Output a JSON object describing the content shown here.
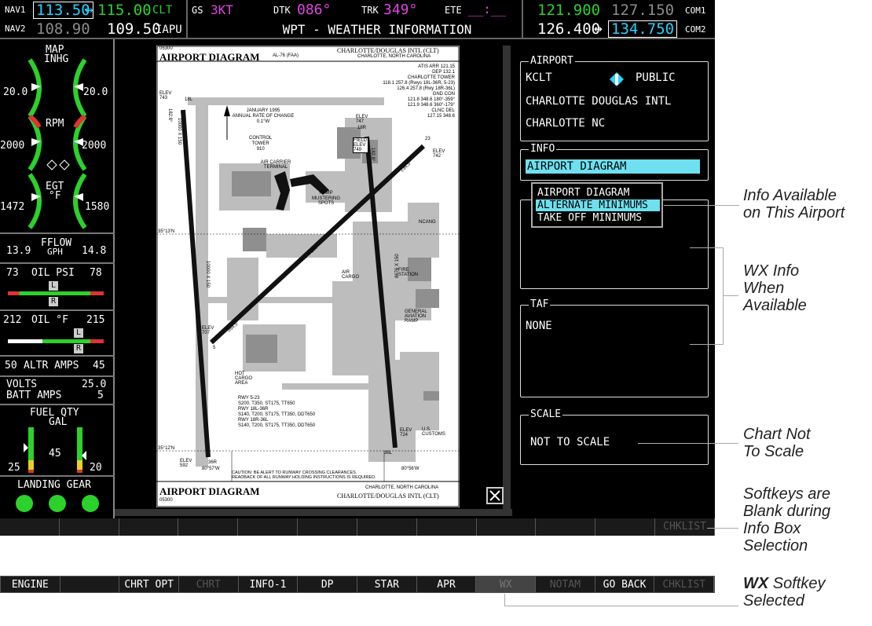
{
  "topbar": {
    "nav1_label": "NAV1",
    "nav1_active": "113.50",
    "nav1_arrow": "↔",
    "nav1_standby": "115.00",
    "nav1_id": "CLT",
    "nav2_label": "NAV2",
    "nav2_active": "108.90",
    "nav2_standby": "109.50",
    "nav2_id": "IAPU",
    "gs_label": "GS",
    "gs_value": "3KT",
    "dtk_label": "DTK",
    "dtk_value": "086°",
    "trk_label": "TRK",
    "trk_value": "349°",
    "ete_label": "ETE",
    "ete_value": "__:__",
    "page_title": "WPT - WEATHER INFORMATION",
    "com1_active": "121.900",
    "com1_standby": "127.150",
    "com1_label": "COM1",
    "com2_active": "126.400",
    "com2_arrow": "↔",
    "com2_standby": "134.750",
    "com2_label": "COM2"
  },
  "eis": {
    "map_label": "MAP",
    "inhg_label": "INHG",
    "map_left": "20.0",
    "map_right": "20.0",
    "rpm_label": "RPM",
    "rpm_left": "2000",
    "rpm_right": "2000",
    "egt_label": "EGT",
    "egt_unit": "°F",
    "egt_left": "1472",
    "egt_right": "1580",
    "fflow_label": "FFLOW",
    "fflow_unit": "GPH",
    "fflow_left": "13.9",
    "fflow_right": "14.8",
    "oilpsi_left": "73",
    "oilpsi_label": "OIL PSI",
    "oilpsi_right": "78",
    "oiltemp_left": "212",
    "oiltemp_label": "OIL °F",
    "oiltemp_right": "215",
    "altr_left": "50",
    "altr_label": "ALTR AMPS",
    "altr_right": "45",
    "volts_label": "VOLTS",
    "volts_value": "25.0",
    "batt_label": "BATT AMPS",
    "batt_value": "5",
    "fuel_label": "FUEL QTY",
    "fuel_unit": "GAL",
    "fuel_left": "25",
    "fuel_mid": "45",
    "fuel_right": "20",
    "gear_label": "LANDING GEAR",
    "l_marker": "L",
    "r_marker": "R"
  },
  "chart": {
    "code_top": "05300",
    "title": "AIRPORT DIAGRAM",
    "al_code": "AL-76 (FAA)",
    "airport_name": "CHARLOTTE/DOUGLAS INTL (CLT)",
    "city": "CHARLOTTE, NORTH CAROLINA",
    "atis": "ATIS ARR 121.15",
    "dep": "DEP 132.1",
    "tower_label": "CHARLOTTE TOWER",
    "tower_freq": "118.1 257.8 (Rwys 18L-36R, 5-23)",
    "tower_freq2": "126.4 257.8 (Rwy 18R-36L)",
    "gnd_label": "GND CON",
    "gnd1": "121.8 348.6 180°-359°",
    "gnd2": "121.9 348.6 360°-179°",
    "clnc_label": "CLNC DEL",
    "clnc": "127.15 348.6",
    "variation": "JANUARY 1995",
    "variation2": "ANNUAL RATE OF CHANGE",
    "variation3": "0.1°W",
    "control_tower": "CONTROL",
    "control_tower2": "TOWER",
    "control_tower3": "910",
    "terminal": "AIR CARRIER TERMINAL",
    "ramp": "RAMP",
    "ramp2": "MUSTERING SPOTS",
    "field_elev": "FIELD ELEV 749",
    "elev_743": "ELEV 743",
    "elev_747": "ELEV 747",
    "elev_742": "ELEV 742",
    "elev_707": "ELEV 707",
    "elev_724": "ELEV 724",
    "elev_592": "ELEV 592",
    "ncang": "NCANG",
    "fire_station": "FIRE STATION",
    "general_aviation": "GENERAL AVIATION RAMP",
    "air_cargo": "AIR CARGO",
    "hot_cargo": "HOT CARGO AREA",
    "customs": "U.S. CUSTOMS",
    "lat1": "35°13'N",
    "lat2": "35°12'N",
    "lon1": "80°57'W",
    "lon2": "80°56'W",
    "rwy_info": "RWY 5-23",
    "rwy_info2": "S200, T350, ST175, TT650",
    "rwy_info3": "RWY 18L-36R",
    "rwy_info4": "S140, T200, ST175, TT350, DDT650",
    "rwy_info5": "RWY 18R-36L",
    "rwy_info6": "S140, T200, ST175, TT350, DDT650",
    "caution": "CAUTION: BE ALERT TO RUNWAY CROSSING CLEARANCES.",
    "caution2": "READBACK OF ALL RUNWAY HOLDING INSTRUCTIONS IS REQUIRED.",
    "footer_title": "AIRPORT DIAGRAM",
    "footer_city": "CHARLOTTE, NORTH CAROLINA",
    "footer_name": "CHARLOTTE/DOUGLAS INTL (CLT)",
    "footer_code": "05300",
    "rwy_left_label": "10000 X 150",
    "rwy_right_label": "8676 X 150",
    "rwy_diag_label": "7502 X 150",
    "rwy_18l": "18L",
    "rwy_36r": "36R",
    "rwy_18r": "18R",
    "rwy_36l": "36L",
    "rwy_5": "5",
    "rwy_23": "23",
    "brg_left": "182.8°",
    "brg_right": "182.8°",
    "brg_5": "054.5°",
    "brg_23": "234.5°"
  },
  "panel": {
    "airport_title": "AIRPORT",
    "airport_id": "KCLT",
    "airport_type": "PUBLIC",
    "airport_name": "CHARLOTTE DOUGLAS INTL",
    "airport_city": "CHARLOTTE NC",
    "info_title": "INFO",
    "info_selected": "AIRPORT DIAGRAM",
    "dropdown": [
      "AIRPORT DIAGRAM",
      "ALTERNATE MINIMUMS",
      "TAKE OFF MINIMUMS"
    ],
    "taf_title": "TAF",
    "taf_value": "NONE",
    "scale_title": "SCALE",
    "scale_value": "NOT TO SCALE"
  },
  "softkeys_blank": [
    "",
    "",
    "",
    "",
    "",
    "",
    "",
    "",
    "",
    "",
    "",
    "CHKLIST"
  ],
  "softkeys": [
    "ENGINE",
    "",
    "CHRT OPT",
    "CHRT",
    "INFO-1",
    "DP",
    "STAR",
    "APR",
    "WX",
    "NOTAM",
    "GO BACK",
    "CHKLIST"
  ],
  "callouts": {
    "info_available": "Info Available on This Airport",
    "info_available_1": "Info Available",
    "info_available_2": "on This Airport",
    "wx_info_1": "WX Info",
    "wx_info_2": "When",
    "wx_info_3": "Available",
    "not_scale_1": "Chart Not",
    "not_scale_2": "To Scale",
    "softkeys_blank_1": "Softkeys are",
    "softkeys_blank_2": "Blank during",
    "softkeys_blank_3": "Info Box",
    "softkeys_blank_4": "Selection",
    "wx_softkey_1": "WX",
    "wx_softkey_2": "Softkey",
    "wx_softkey_3": "Selected"
  },
  "colors": {
    "accent_cyan": "#29d2ff",
    "magenta": "#e046e0",
    "green": "#2cd12c",
    "highlight": "#6ee0ef"
  }
}
